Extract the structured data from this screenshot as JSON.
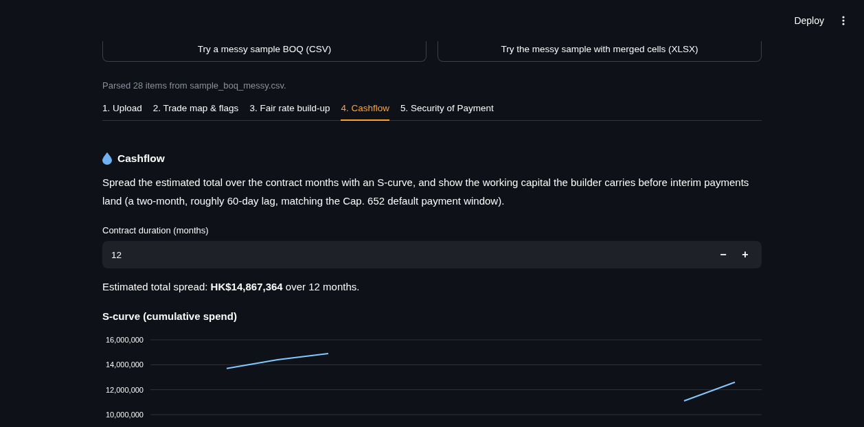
{
  "header": {
    "deploy": "Deploy"
  },
  "sample_buttons": [
    "Try a messy sample BOQ (CSV)",
    "Try the messy sample with merged cells (XLSX)"
  ],
  "parse_status": "Parsed 28 items from sample_boq_messy.csv.",
  "tabs": [
    {
      "label": "1. Upload",
      "selected": false
    },
    {
      "label": "2. Trade map & flags",
      "selected": false
    },
    {
      "label": "3. Fair rate build-up",
      "selected": false
    },
    {
      "label": "4. Cashflow",
      "selected": true
    },
    {
      "label": "5. Security of Payment",
      "selected": false
    }
  ],
  "section": {
    "title": "Cashflow",
    "description": "Spread the estimated total over the contract months with an S-curve, and show the working capital the builder carries before interim payments land (a two-month, roughly 60-day lag, matching the Cap. 652 default payment window).",
    "duration_field": {
      "label": "Contract duration (months)",
      "value": "12",
      "decrement": "−",
      "increment": "+"
    },
    "summary": "Estimated total spread: **HK$14,867,364** over 12 months.",
    "chart_title": "S-curve (cumulative spend)",
    "chart_data": {
      "type": "line",
      "ylim": [
        10000000,
        16000000
      ],
      "grid": true,
      "series": [
        {
          "color": "#83c9ff",
          "values": [
            null,
            13700000,
            14400000,
            14900000,
            null,
            null,
            null,
            null,
            null,
            null,
            11100000,
            12600000
          ]
        }
      ],
      "yticks": [
        {
          "value": 10000000,
          "label": "10,000,000"
        },
        {
          "value": 12000000,
          "label": "12,000,000"
        },
        {
          "value": 14000000,
          "label": "14,000,000"
        },
        {
          "value": 16000000,
          "label": "16,000,000"
        }
      ]
    }
  }
}
